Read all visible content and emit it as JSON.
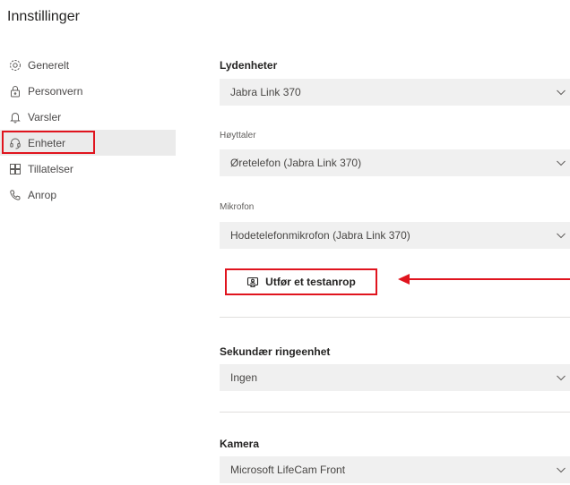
{
  "page": {
    "title": "Innstillinger"
  },
  "nav": {
    "items": [
      {
        "label": "Generelt",
        "icon": "gear-icon"
      },
      {
        "label": "Personvern",
        "icon": "lock-icon"
      },
      {
        "label": "Varsler",
        "icon": "bell-icon"
      },
      {
        "label": "Enheter",
        "icon": "headset-icon",
        "active": true
      },
      {
        "label": "Tillatelser",
        "icon": "apps-icon"
      },
      {
        "label": "Anrop",
        "icon": "phone-icon"
      }
    ]
  },
  "devices": {
    "audio": {
      "title": "Lydenheter",
      "selected": "Jabra Link 370",
      "speaker_label": "Høyttaler",
      "speaker_value": "Øretelefon (Jabra Link 370)",
      "mic_label": "Mikrofon",
      "mic_value": "Hodetelefonmikrofon (Jabra Link 370)"
    },
    "test_call_label": "Utfør et testanrop",
    "secondary_ringer": {
      "title": "Sekundær ringeenhet",
      "value": "Ingen"
    },
    "camera": {
      "title": "Kamera",
      "value": "Microsoft LifeCam Front"
    }
  },
  "colors": {
    "highlight": "#e0141e",
    "select_bg": "#f0f0f0",
    "active_nav_bg": "#ebebeb"
  }
}
